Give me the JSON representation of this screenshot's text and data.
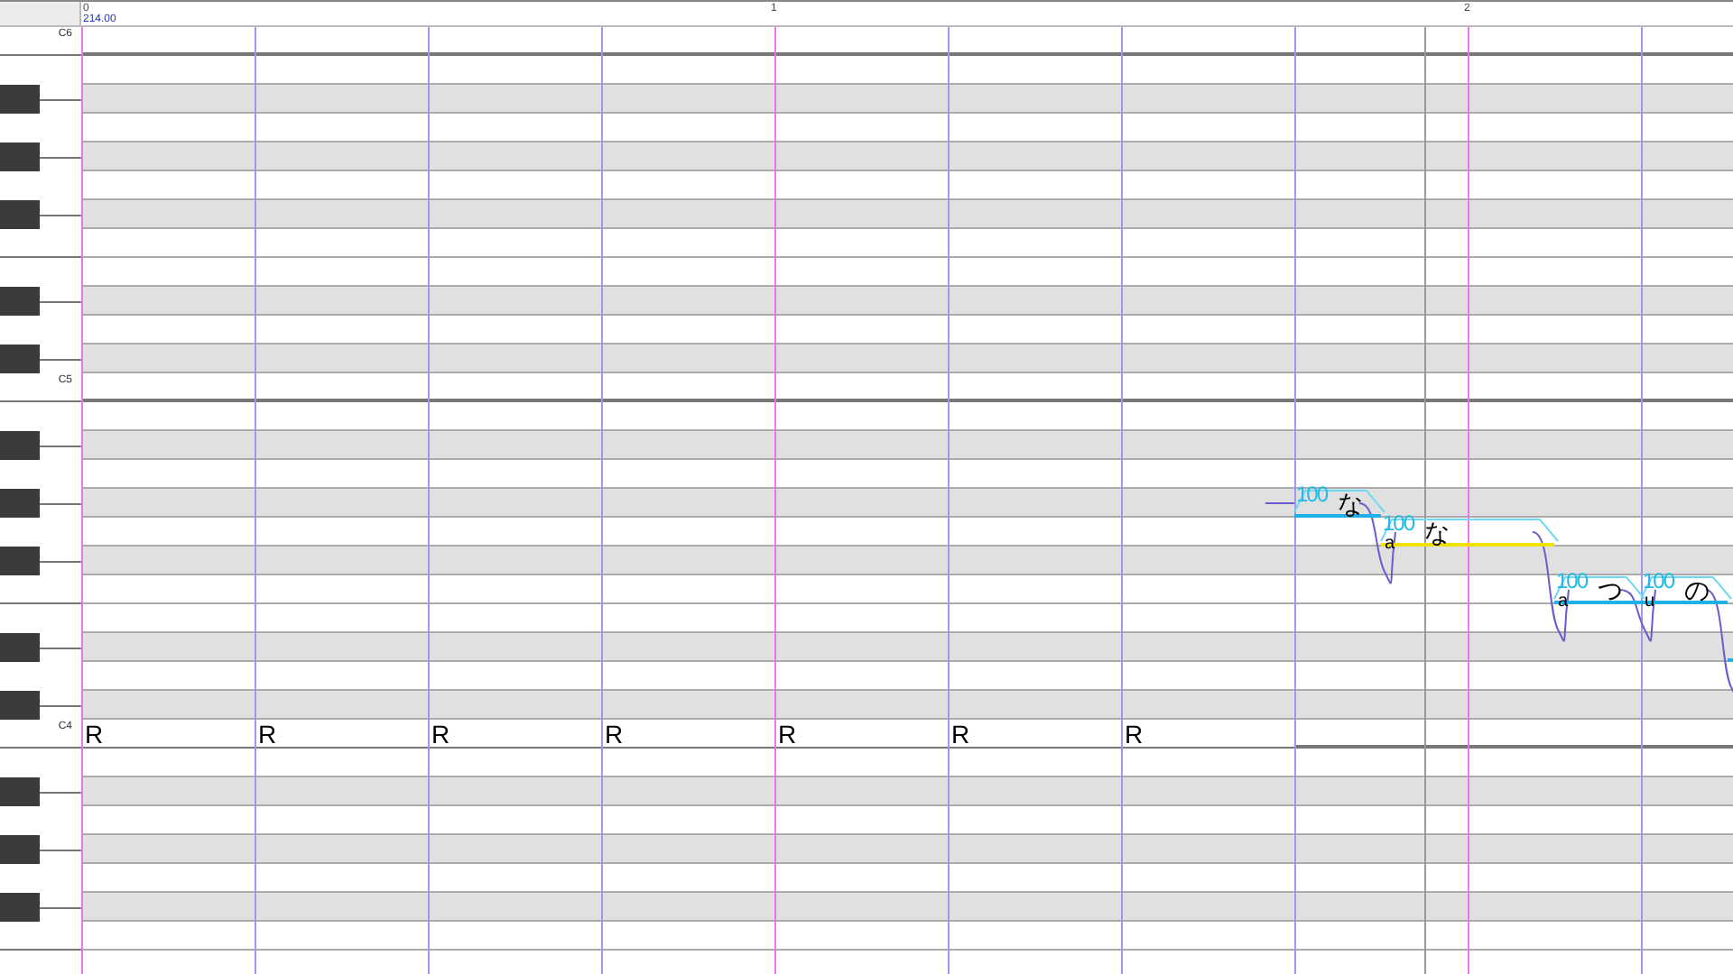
{
  "ruler": {
    "start": "0",
    "tempo": "214.00",
    "measures": [
      "1",
      "2"
    ]
  },
  "keyboard": {
    "octave_labels": [
      "C6",
      "C5",
      "C4"
    ]
  },
  "notes": [
    {
      "kind": "rest",
      "lyric": "R"
    },
    {
      "kind": "rest",
      "lyric": "R"
    },
    {
      "kind": "rest",
      "lyric": "R"
    },
    {
      "kind": "rest",
      "lyric": "R"
    },
    {
      "kind": "rest",
      "lyric": "R"
    },
    {
      "kind": "rest",
      "lyric": "R"
    },
    {
      "kind": "rest",
      "lyric": "R"
    },
    {
      "kind": "note",
      "lyric": "な",
      "velocity": "100",
      "selected": false
    },
    {
      "kind": "note",
      "prefix": "a",
      "lyric": "な",
      "velocity": "100",
      "selected": true
    },
    {
      "kind": "note",
      "prefix": "a",
      "lyric": "つ",
      "velocity": "100",
      "selected": false
    },
    {
      "kind": "note",
      "prefix": "u",
      "lyric": "の",
      "velocity": "100",
      "selected": false
    },
    {
      "kind": "note",
      "selected": false
    }
  ]
}
